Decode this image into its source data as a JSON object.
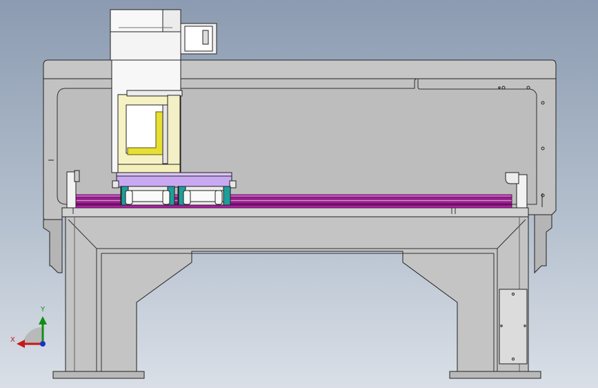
{
  "viewport": {
    "background_top": "#8c9bb1",
    "background_bottom": "#dadfe7"
  },
  "triad": {
    "x_label": "X",
    "y_label": "Y",
    "x_color": "#c81818",
    "y_color": "#0f8f14",
    "z_color": "#1833c8"
  },
  "model_colors": {
    "frame": "#c6c6c6",
    "frame_dark": "#a9a9a9",
    "outline": "#202020",
    "rail": "#c31fb4",
    "carriage_plate": "#c7a8f0",
    "column": "#f5f1c4",
    "highlight": "#e8e03a",
    "white_parts": "#f7f7f7"
  }
}
